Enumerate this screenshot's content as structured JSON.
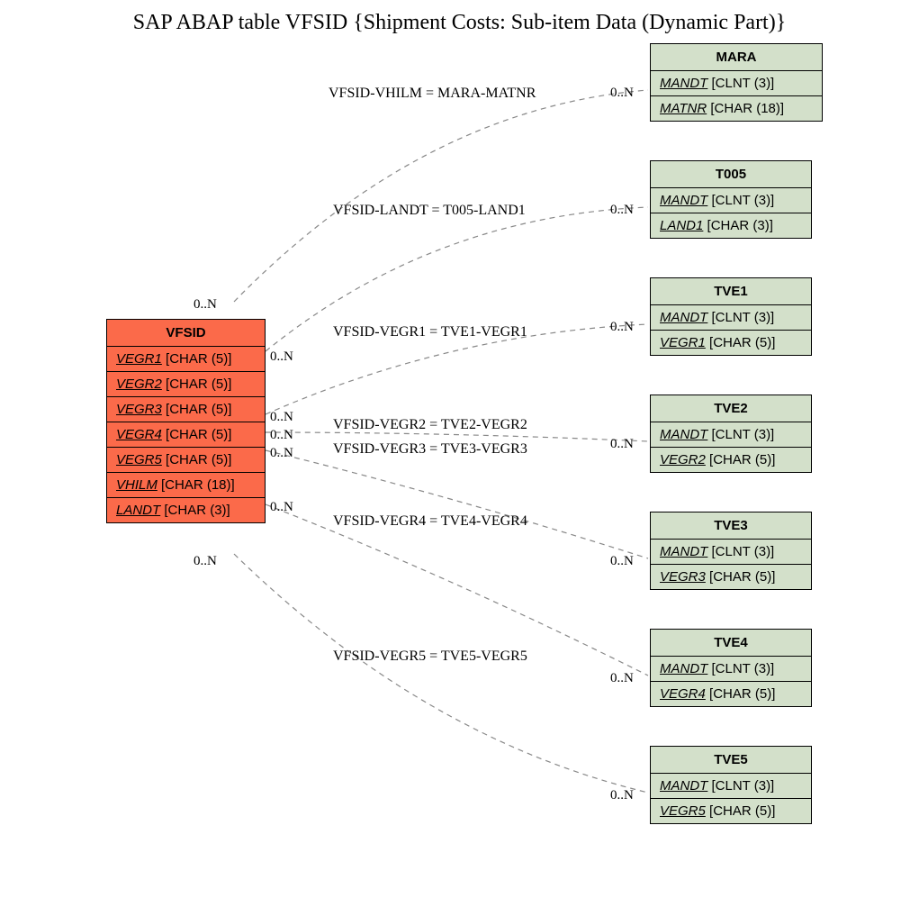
{
  "title": "SAP ABAP table VFSID {Shipment Costs: Sub-item Data (Dynamic Part)}",
  "vfsid": {
    "name": "VFSID",
    "rows": [
      {
        "field": "VEGR1",
        "type": " [CHAR (5)]"
      },
      {
        "field": "VEGR2",
        "type": " [CHAR (5)]"
      },
      {
        "field": "VEGR3",
        "type": " [CHAR (5)]"
      },
      {
        "field": "VEGR4",
        "type": " [CHAR (5)]"
      },
      {
        "field": "VEGR5",
        "type": " [CHAR (5)]"
      },
      {
        "field": "VHILM",
        "type": " [CHAR (18)]"
      },
      {
        "field": "LANDT",
        "type": " [CHAR (3)]"
      }
    ]
  },
  "targets": [
    {
      "name": "MARA",
      "rows": [
        {
          "field": "MANDT",
          "type": " [CLNT (3)]"
        },
        {
          "field": "MATNR",
          "type": " [CHAR (18)]"
        }
      ]
    },
    {
      "name": "T005",
      "rows": [
        {
          "field": "MANDT",
          "type": " [CLNT (3)]"
        },
        {
          "field": "LAND1",
          "type": " [CHAR (3)]"
        }
      ]
    },
    {
      "name": "TVE1",
      "rows": [
        {
          "field": "MANDT",
          "type": " [CLNT (3)]"
        },
        {
          "field": "VEGR1",
          "type": " [CHAR (5)]"
        }
      ]
    },
    {
      "name": "TVE2",
      "rows": [
        {
          "field": "MANDT",
          "type": " [CLNT (3)]"
        },
        {
          "field": "VEGR2",
          "type": " [CHAR (5)]"
        }
      ]
    },
    {
      "name": "TVE3",
      "rows": [
        {
          "field": "MANDT",
          "type": " [CLNT (3)]"
        },
        {
          "field": "VEGR3",
          "type": " [CHAR (5)]"
        }
      ]
    },
    {
      "name": "TVE4",
      "rows": [
        {
          "field": "MANDT",
          "type": " [CLNT (3)]"
        },
        {
          "field": "VEGR4",
          "type": " [CHAR (5)]"
        }
      ]
    },
    {
      "name": "TVE5",
      "rows": [
        {
          "field": "MANDT",
          "type": " [CLNT (3)]"
        },
        {
          "field": "VEGR5",
          "type": " [CHAR (5)]"
        }
      ]
    }
  ],
  "relations": [
    "VFSID-VHILM = MARA-MATNR",
    "VFSID-LANDT = T005-LAND1",
    "VFSID-VEGR1 = TVE1-VEGR1",
    "VFSID-VEGR2 = TVE2-VEGR2",
    "VFSID-VEGR3 = TVE3-VEGR3",
    "VFSID-VEGR4 = TVE4-VEGR4",
    "VFSID-VEGR5 = TVE5-VEGR5"
  ],
  "card": "0..N"
}
